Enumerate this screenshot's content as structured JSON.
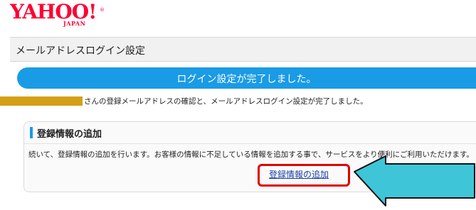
{
  "logo": {
    "text": "YAHOO!",
    "sub": "JAPAN",
    "reg": "®"
  },
  "header": {
    "title": "メールアドレスログイン設定"
  },
  "banner": {
    "text": "ログイン設定が完了しました。"
  },
  "message": {
    "text": "さんの登録メールアドレスの確認と、メールアドレスログイン設定が完了しました。"
  },
  "section": {
    "title": "登録情報の追加",
    "description": "続いて、登録情報の追加を行います。お客様の情報に不足している情報を追加する事で、サービスをより便利にご利用いただけます。",
    "link_label": "登録情報の追加"
  },
  "colors": {
    "brand": "#ff0033",
    "accent": "#1a9be6",
    "highlight": "#e00000",
    "arrow": "#3ec6d8",
    "redaction": "#d4a017"
  }
}
